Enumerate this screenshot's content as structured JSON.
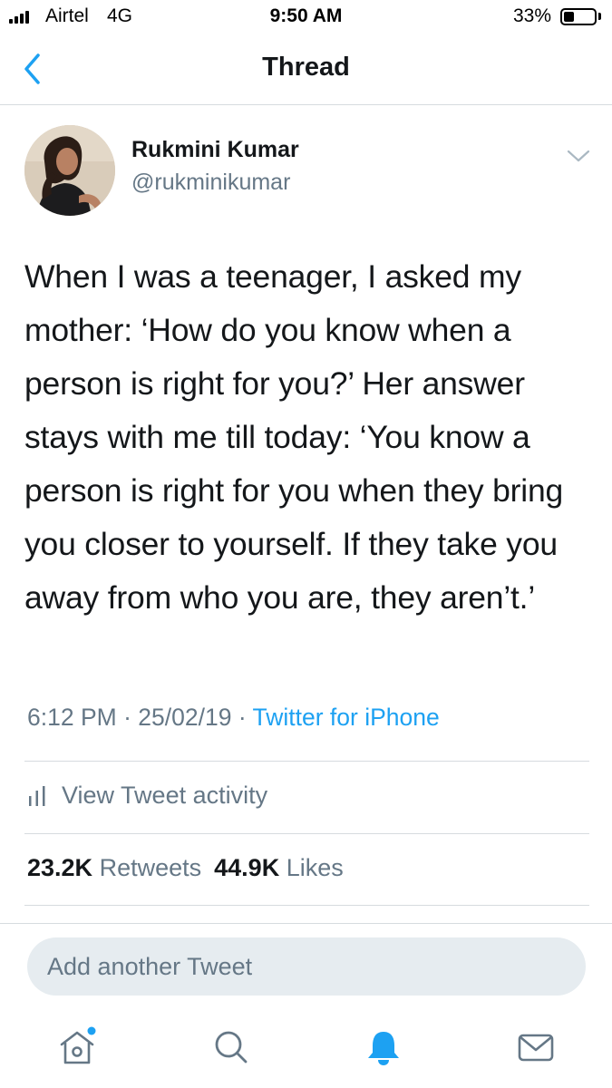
{
  "status_bar": {
    "carrier": "Airtel",
    "network": "4G",
    "time": "9:50 AM",
    "battery_percent": "33%",
    "battery_level": 0.33
  },
  "nav": {
    "title": "Thread",
    "back_icon": "chevron-left-icon"
  },
  "tweet": {
    "author_name": "Rukmini Kumar",
    "author_handle": "@rukminikumar",
    "text": "When I was a teenager, I asked my mother: ‘How do you know when a person is right for you?’ Her answer stays with me till today: ‘You know a person is right for you when they bring you closer to yourself. If they take you away from who you are, they aren’t.’",
    "time": "6:12 PM",
    "separator": "·",
    "date": "25/02/19",
    "source": "Twitter for iPhone",
    "activity_label": "View Tweet activity",
    "retweets_count": "23.2K",
    "retweets_label": "Retweets",
    "likes_count": "44.9K",
    "likes_label": "Likes"
  },
  "compose": {
    "placeholder": "Add another Tweet"
  },
  "tab_bar": {
    "tabs": [
      "home-icon",
      "search-icon",
      "notifications-icon",
      "messages-icon"
    ]
  },
  "colors": {
    "accent": "#1da1f2",
    "text_primary": "#14171a",
    "text_secondary": "#657786",
    "divider": "#d6dbdf",
    "compose_bg": "#e6ecf0"
  }
}
